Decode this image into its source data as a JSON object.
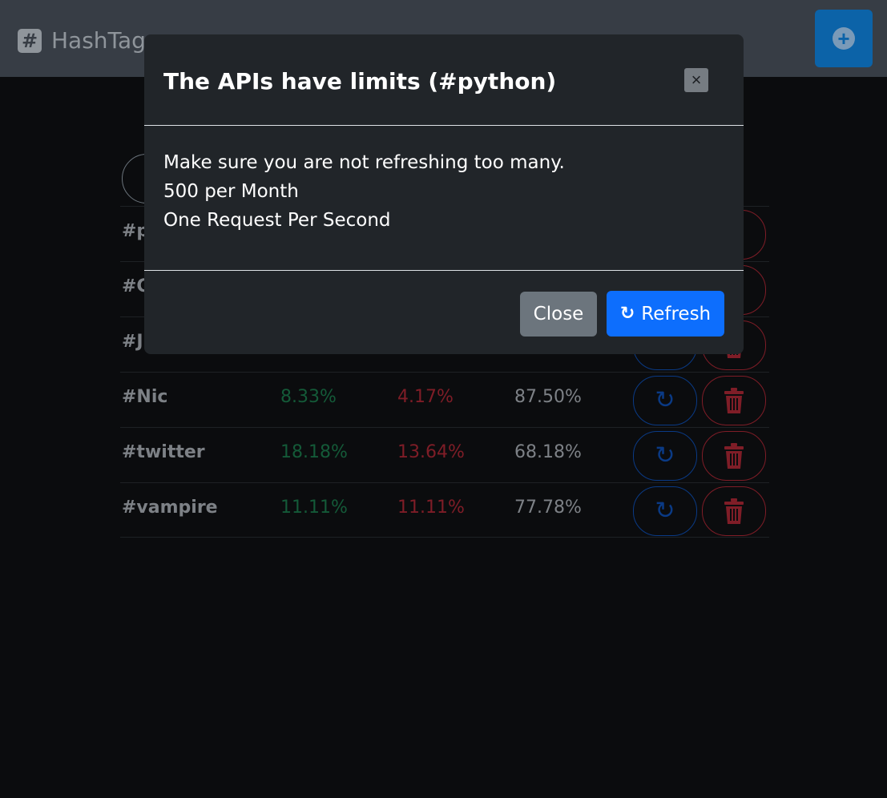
{
  "navbar": {
    "brand_icon": "#",
    "brand_text": "HashTags",
    "add_icon": "+"
  },
  "table": {
    "rows": [
      {
        "tag": "#p",
        "positive": "",
        "negative": "",
        "neutral": ""
      },
      {
        "tag": "#C",
        "positive": "",
        "negative": "",
        "neutral": ""
      },
      {
        "tag": "#Ju",
        "positive": "",
        "negative": "",
        "neutral": ""
      },
      {
        "tag": "#Nic",
        "positive": "8.33%",
        "negative": "4.17%",
        "neutral": "87.50%"
      },
      {
        "tag": "#twitter",
        "positive": "18.18%",
        "negative": "13.64%",
        "neutral": "68.18%"
      },
      {
        "tag": "#vampire",
        "positive": "11.11%",
        "negative": "11.11%",
        "neutral": "77.78%"
      }
    ],
    "refresh_icon": "↻"
  },
  "modal": {
    "title": "The APIs have limits (#python)",
    "close_icon": "×",
    "body_lines": [
      "Make sure you are not refreshing too many.",
      "500 per Month",
      "One Request Per Second"
    ],
    "close_label": "Close",
    "refresh_icon": "↻",
    "refresh_label": "Refresh"
  },
  "colors": {
    "primary": "#0d6efd",
    "secondary": "#6c757d",
    "positive": "#198754",
    "negative": "#dc3545"
  }
}
